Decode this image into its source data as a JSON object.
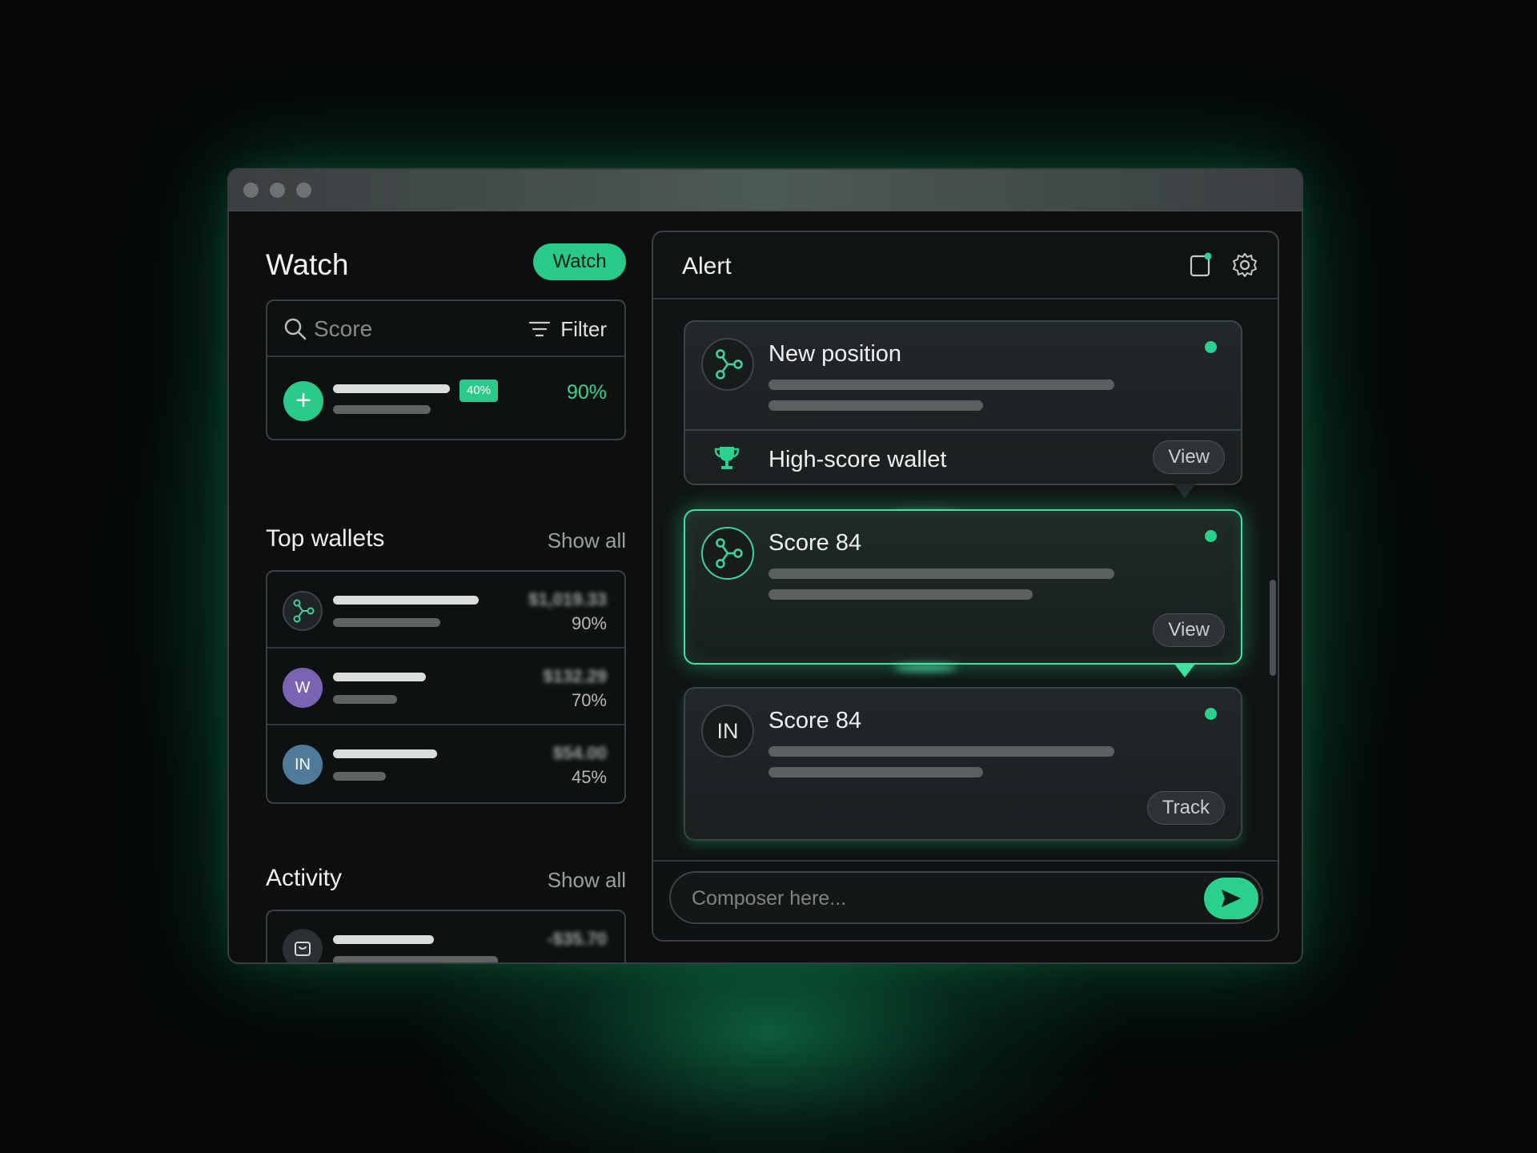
{
  "left": {
    "title": "Watch",
    "watch_button": "Watch",
    "search": {
      "placeholder": "Score",
      "filter_label": "Filter"
    },
    "watch_item": {
      "badge": "40%",
      "percent": "90%"
    },
    "top_wallets": {
      "title": "Top wallets",
      "show_all": "Show all",
      "items": [
        {
          "avatar": "network-icon",
          "amount": "$1,019.33",
          "percent": "90%"
        },
        {
          "avatar": "W",
          "amount": "$132.29",
          "percent": "70%"
        },
        {
          "avatar": "IN",
          "amount": "$54.00",
          "percent": "45%"
        }
      ]
    },
    "activity": {
      "title": "Activity",
      "show_all": "Show all",
      "items": [
        {
          "amount": "-$35.70"
        }
      ]
    }
  },
  "right": {
    "title": "Alert",
    "cards": [
      {
        "title": "New position",
        "sub_label": "High-score wallet",
        "action": "View"
      },
      {
        "title": "Score 84",
        "action": "View"
      },
      {
        "avatar": "IN",
        "title": "Score 84",
        "action": "Track"
      }
    ],
    "composer": {
      "placeholder": "Composer here..."
    }
  },
  "colors": {
    "accent": "#2bc98a",
    "background": "#050708",
    "panel": "#0e1112",
    "purple_avatar": "#7b63b3",
    "blue_avatar": "#4f7a9a"
  }
}
